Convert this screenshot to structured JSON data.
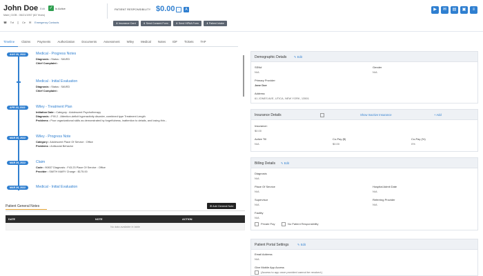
{
  "patient": {
    "name": "John Doe",
    "edit_label": "Edit",
    "active_label": "Is Active",
    "demographic_line": "Male | DOB : 06/21/1957 (63 Years)",
    "phone_label": "Txt",
    "cell_label": "Ce",
    "emergency_label": "Emergency Contacts"
  },
  "responsibility": {
    "label": "PATIENT RESPONSIBILITY",
    "amount": "$0.00"
  },
  "actions": [
    "Insurance Card",
    "Send Consent Form",
    "Send HIPAA Form",
    "Patient Intake"
  ],
  "tabs": [
    "Timeline",
    "Claims",
    "Payments",
    "Authorization",
    "Documents",
    "Assessment",
    "Wiley",
    "Medical",
    "Notes",
    "IDF",
    "Tickets",
    "TAP"
  ],
  "timeline": [
    {
      "date": "AUG 20, 2022",
      "title": "Medical - Progress Notes",
      "lines": [
        {
          "k": "Diagnosis :",
          "v": " Status : SAVED"
        },
        {
          "k": "Chief Complaint :",
          "v": ""
        }
      ]
    },
    {
      "date": "",
      "title": "Medical - Initial Evaluation",
      "lines": [
        {
          "k": "Diagnosis :",
          "v": " Status : SAVED"
        },
        {
          "k": "Chief Complaint :",
          "v": ""
        }
      ]
    },
    {
      "date": "APR 20, 2022",
      "title": "Wiley - Treatment Plan",
      "lines": [
        {
          "k": "Initiation Date :",
          "v": " Category : Adolescent Psychotherapy"
        },
        {
          "k": "Diagnosis :",
          "v": " F90.2 - Attention-deficit hyperactivity disorder, combined type  Treatment Length"
        },
        {
          "k": "Problems :",
          "v": " Poor organizational skills as demonstrated by forgetfulness, inattention to details, and losing thin..."
        }
      ]
    },
    {
      "date": "MAR 30, 2022",
      "title": "Wiley - Progress Note",
      "lines": [
        {
          "k": "Category :",
          "v": " Adolescent Place Of Service : Office"
        },
        {
          "k": "Problems :",
          "v": " Antisocial Behavior"
        }
      ]
    },
    {
      "date": "MAR 29, 2022",
      "title": "Claim",
      "lines": [
        {
          "k": "Code :",
          "v": " 90837 Diagnosis : F43.23 Place Of Service : Office"
        },
        {
          "k": "Provider :",
          "v": " SMITH MARY Charge : $175.00"
        }
      ]
    },
    {
      "date": "MAR 29, 2022",
      "title": "Medical - Initial Evaluation",
      "lines": []
    }
  ],
  "notes": {
    "title": "Patient General Notes",
    "add_label": "Add General Note",
    "columns": [
      "DATE",
      "NOTE",
      "ACTION"
    ],
    "empty": "No data available in table"
  },
  "demographics": {
    "title": "Demographic Details",
    "edit": "Edit",
    "ssn_label": "SSN#",
    "ssn_value": "N/A",
    "gender_label": "Gender",
    "gender_value": "N/A",
    "provider_label": "Primary Provider",
    "provider_value": "Jane Doe",
    "address_label": "Address",
    "address_value": "61 JONES AVE, UTICA, NEW YORK, 13501"
  },
  "insurance": {
    "title": "Insurance Details",
    "show_inactive": "Show Inactive Insurance",
    "add": "Add",
    "insurance_label": "Insurance:",
    "insurance_value": "$0.00",
    "active_till_label": "Active Till",
    "active_till_value": "N/A",
    "copay_label": "Co-Pay ($)",
    "copay_value": "$0.00",
    "copay_pct_label": "Co-Pay (%)",
    "copay_pct_value": "0%"
  },
  "billing": {
    "title": "Billing Details",
    "edit": "Edit",
    "diagnosis_label": "Diagnosis",
    "diagnosis_value": "N/A",
    "pos_label": "Place Of Service",
    "pos_value": "N/A",
    "hospital_label": "Hospital Admit Date",
    "hospital_value": "N/A",
    "supervisor_label": "Supervisor",
    "supervisor_value": "N/A",
    "referring_label": "Referring Provider",
    "referring_value": "N/A",
    "facility_label": "Facility",
    "facility_value": "N/A",
    "private_pay": "Private Pay",
    "no_resp": "No Patient Responsibility"
  },
  "portal": {
    "title": "Patient Portal Settings",
    "edit": "Edit",
    "email_label": "Email Address",
    "email_value": "N/A",
    "mobile_label": "Give Mobile App Access",
    "mobile_hint": "(Access to app once provided cannot be revoked.)"
  }
}
